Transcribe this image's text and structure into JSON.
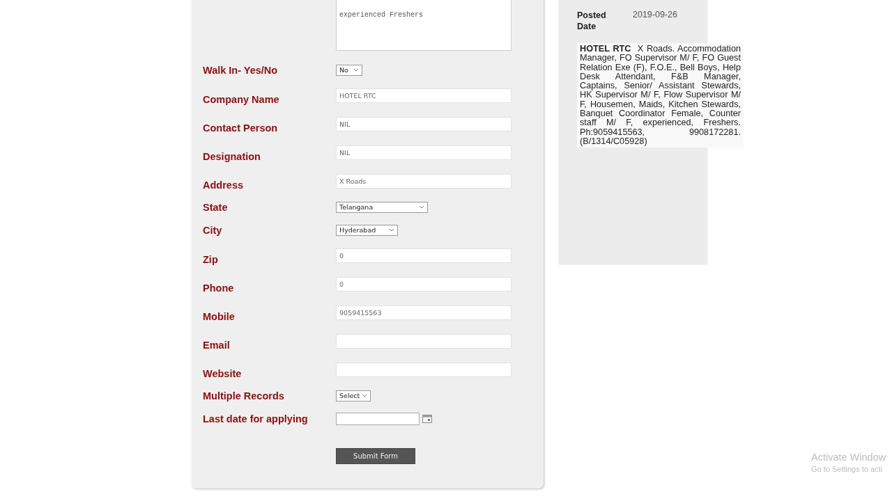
{
  "form": {
    "description": {
      "lines": [
        "experienced Freshers"
      ]
    },
    "fields": [
      {
        "kind": "select",
        "label": "Walk In- Yes/No",
        "value": "No"
      },
      {
        "kind": "text",
        "label": "Company Name",
        "value": "HOTEL RTC"
      },
      {
        "kind": "text",
        "label": "Contact Person",
        "value": "NIL"
      },
      {
        "kind": "text",
        "label": "Designation",
        "value": "NIL"
      },
      {
        "kind": "text",
        "label": "Address",
        "value": "X Roads"
      },
      {
        "kind": "select",
        "label": "State",
        "value": "Telangana"
      },
      {
        "kind": "select",
        "label": "City",
        "value": "Hyderabad"
      },
      {
        "kind": "text",
        "label": "Zip",
        "value": "0"
      },
      {
        "kind": "text",
        "label": "Phone",
        "value": "0"
      },
      {
        "kind": "text",
        "label": "Mobile",
        "value": "9059415563"
      },
      {
        "kind": "text",
        "label": "Email"
      },
      {
        "kind": "text",
        "label": "Website"
      },
      {
        "kind": "select",
        "label": "Multiple Records",
        "value": "Select"
      },
      {
        "kind": "date",
        "label": "Last date for applying"
      }
    ],
    "submit": "Submit Form"
  },
  "preview": {
    "posted_label": "Posted Date",
    "posted_value": "2019-09-26",
    "company": "HOTEL RTC",
    "text": "X Roads. Accommodation Manager, FO Supervisor M/ F, FO Guest Relation Exe (F), F.O.E., Bell Boys, Help Desk Attendant, F&B Manager, Captains, Senior/ Assistant Stewards, HK Supervisor M/ F, Flow Supervisor M/ F, Housemen, Maids, Kitchen Stewards, Banquet Coordinator Female, Counter staff M/ F, experienced, Freshers. Ph:9059415563, 9908172281. (B/1314/C05928)"
  },
  "watermark": {
    "title": "Activate Window",
    "subtitle": "Go to Settings to acti"
  }
}
